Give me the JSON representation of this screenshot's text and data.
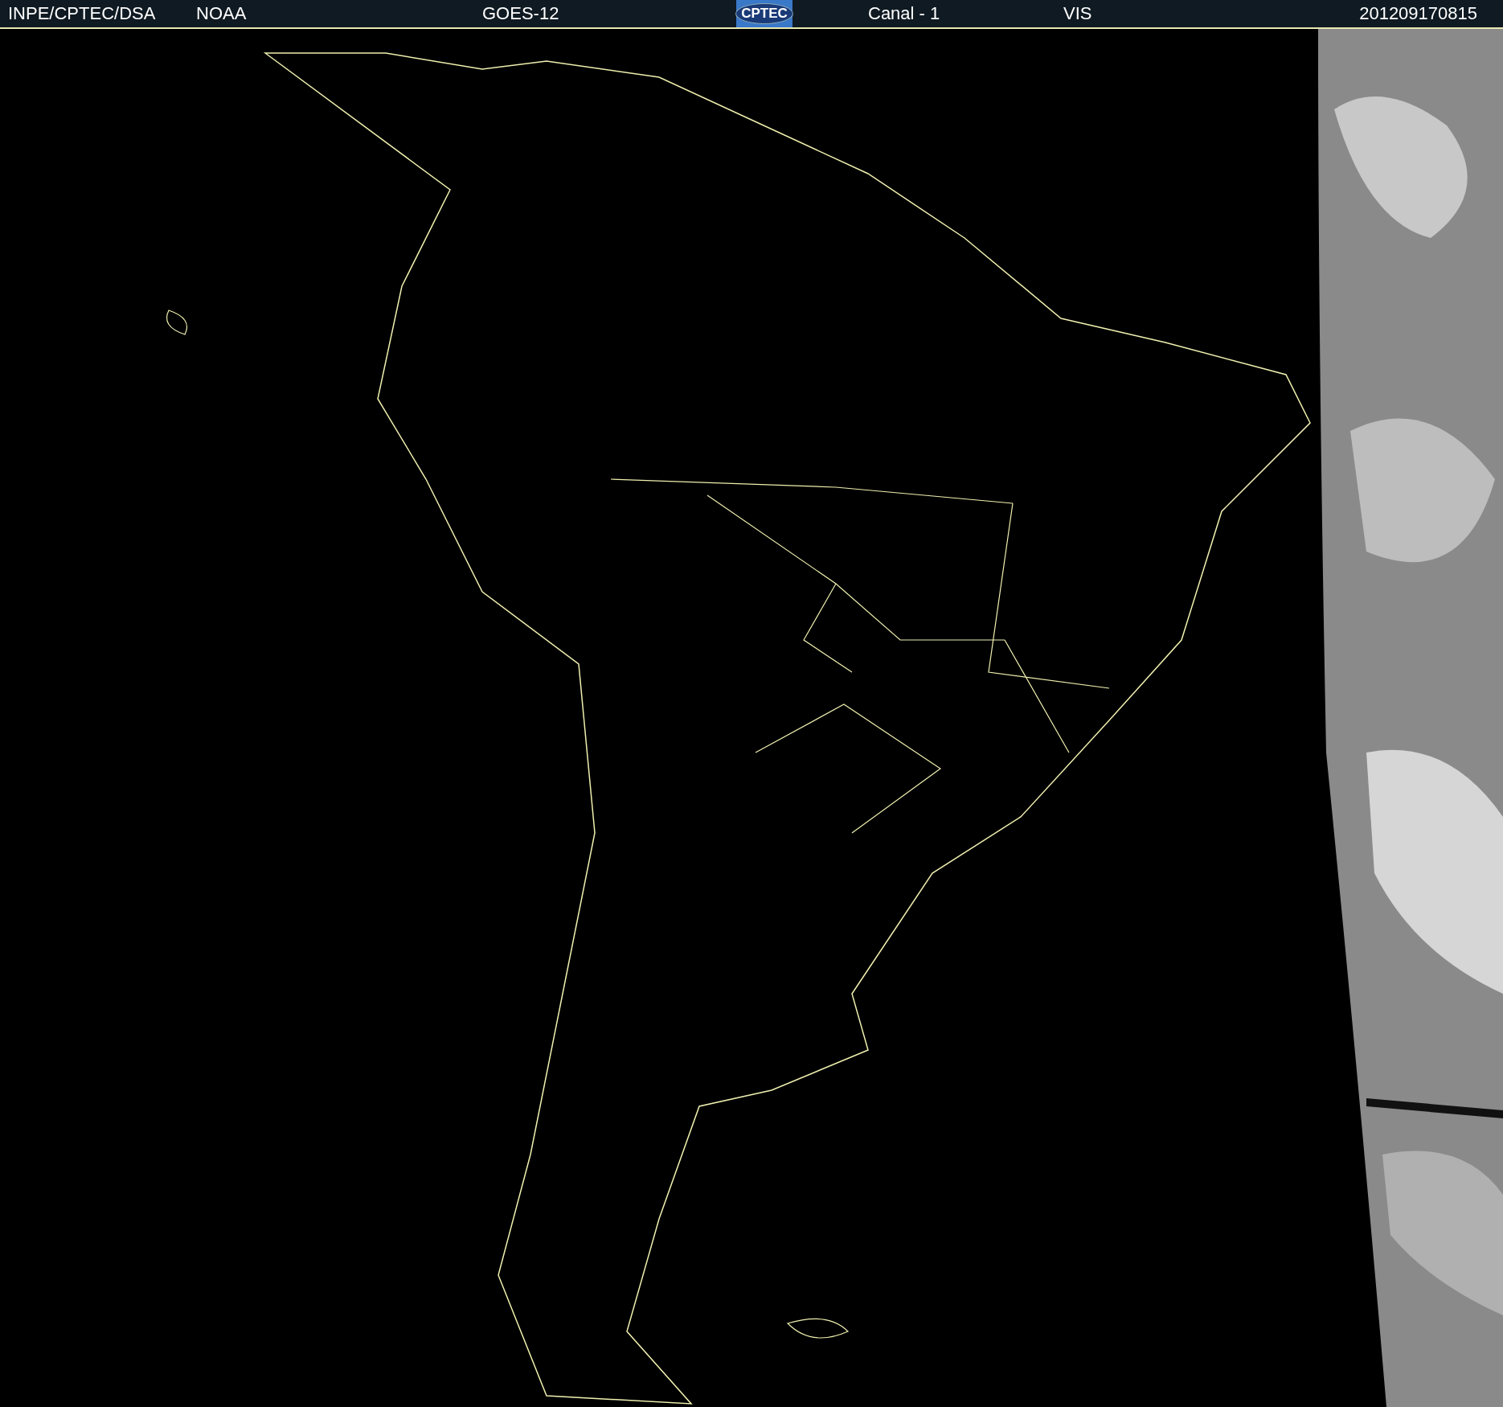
{
  "header": {
    "items": [
      {
        "kind": "text",
        "text": "INPE/CPTEC/DSA"
      },
      {
        "kind": "text",
        "text": "NOAA"
      },
      {
        "kind": "text",
        "text": "GOES-12"
      },
      {
        "kind": "logo",
        "text": "CPTEC"
      },
      {
        "kind": "text",
        "text": "Canal - 1"
      },
      {
        "kind": "text",
        "text": "VIS"
      },
      {
        "kind": "text",
        "text": "201209170815"
      }
    ]
  }
}
